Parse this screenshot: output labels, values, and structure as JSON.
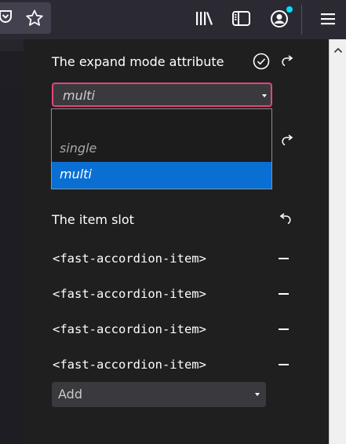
{
  "toolbar": {
    "icons": [
      "pocket-icon",
      "bookmark-star-icon",
      "library-icon",
      "sidebar-icon",
      "account-icon",
      "menu-icon"
    ]
  },
  "panel": {
    "expand_mode": {
      "label": "The expand mode attribute",
      "selected": "multi",
      "options": [
        "",
        "single",
        "multi"
      ]
    },
    "item_slot": {
      "label": "The item slot",
      "items": [
        "<fast-accordion-item>",
        "<fast-accordion-item>",
        "<fast-accordion-item>",
        "<fast-accordion-item>"
      ],
      "add_label": "Add"
    }
  },
  "colors": {
    "select_border": "#e5437a",
    "option_highlight": "#0a6fd2",
    "panel_bg": "#1f1f1f",
    "toolbar_bg": "#2b2a33"
  }
}
